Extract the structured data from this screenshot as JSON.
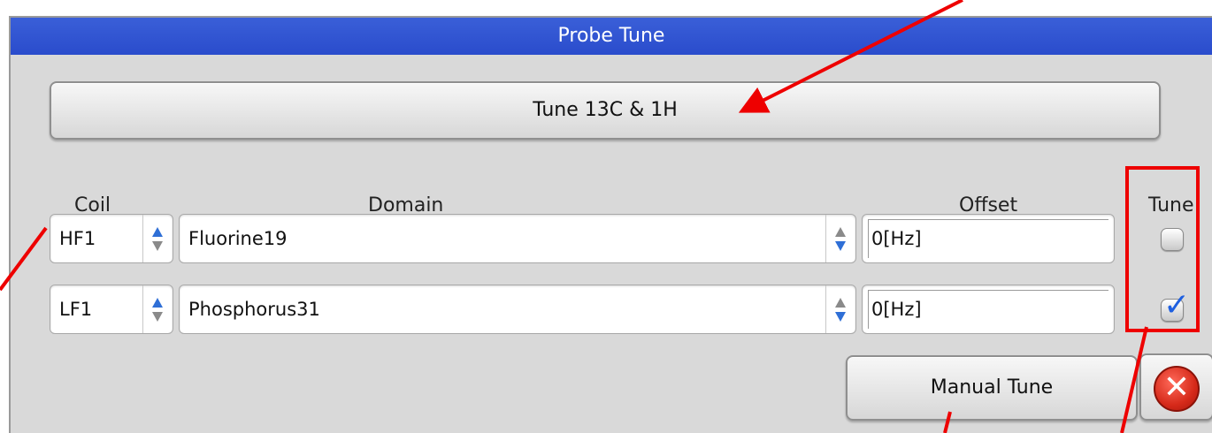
{
  "window": {
    "title": "Probe Tune"
  },
  "actions": {
    "tune_label": "Tune 13C & 1H",
    "manual_tune_label": "Manual Tune",
    "close_icon": "close-icon",
    "close_glyph": "✕"
  },
  "headers": {
    "coil": "Coil",
    "domain": "Domain",
    "offset": "Offset",
    "tune": "Tune"
  },
  "rows": [
    {
      "coil": "HF1",
      "domain": "Fluorine19",
      "offset": "0[Hz]",
      "tune_checked": false
    },
    {
      "coil": "LF1",
      "domain": "Phosphorus31",
      "offset": "0[Hz]",
      "tune_checked": true
    }
  ],
  "colors": {
    "title_bar": "#2a4ccc",
    "annotation": "#ee0000",
    "check": "#1e5fe0"
  }
}
